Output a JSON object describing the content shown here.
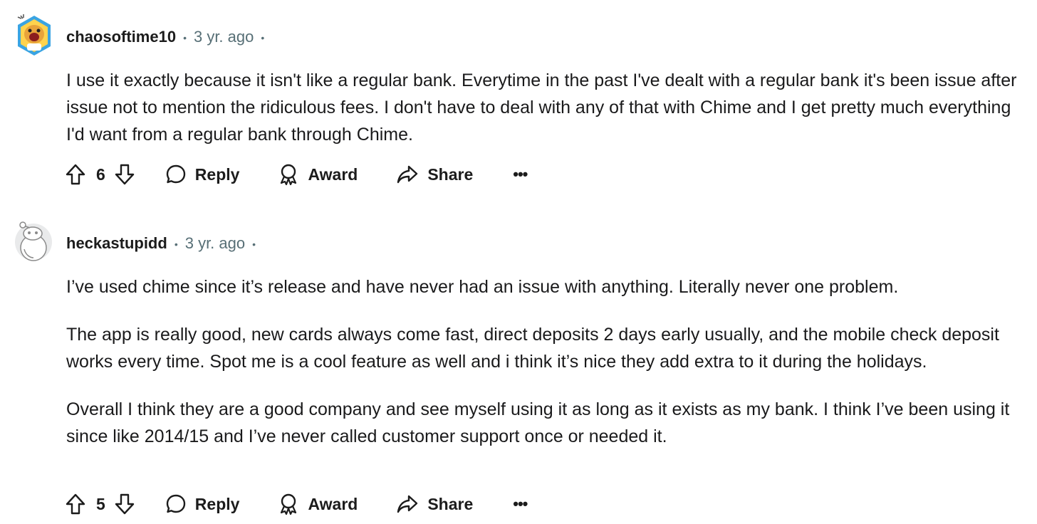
{
  "comments": [
    {
      "username": "chaosoftime10",
      "time": "3 yr. ago",
      "paragraphs": [
        "I use it exactly because it isn't like a regular bank. Everytime in the past I've dealt with a regular bank it's been issue after issue not to mention the ridiculous fees. I don't have to deal with any of that with Chime and I get pretty much everything I'd want from a regular bank through Chime."
      ],
      "votes": "6",
      "avatar_icon": "dog-avatar-icon"
    },
    {
      "username": "heckastupidd",
      "time": "3 yr. ago",
      "paragraphs": [
        "I’ve used chime since it’s release and have never had an issue with anything. Literally never one problem.",
        "The app is really good, new cards always come fast, direct deposits 2 days early usually, and the mobile check deposit works every time. Spot me is a cool feature as well and i think it’s nice they add extra to it during the holidays.",
        "Overall I think they are a good company and see myself using it as long as it exists as my bank. I think I’ve been using it since like 2014/15 and I’ve never called customer support once or needed it."
      ],
      "votes": "5",
      "avatar_icon": "snoo-avatar-icon"
    }
  ],
  "actions": {
    "reply": "Reply",
    "award": "Award",
    "share": "Share",
    "more": "•••"
  },
  "meta_separator": "•",
  "colors": {
    "text": "#1a1a1b",
    "muted": "#576f76",
    "avatar_hex": "#3aa4e3"
  }
}
